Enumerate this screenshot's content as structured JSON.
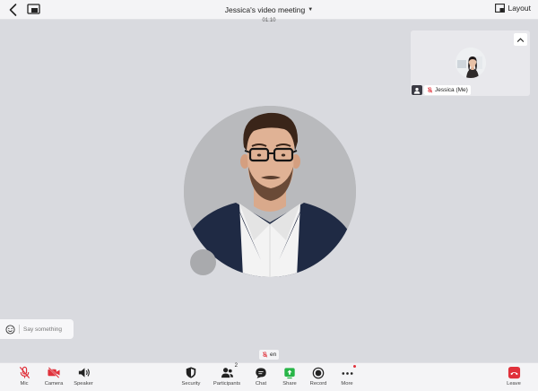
{
  "header": {
    "meeting_title": "Jessica's video meeting",
    "timer": "01:10",
    "layout_label": "Layout"
  },
  "self_view": {
    "name": "Jessica (Me)"
  },
  "chat_input": {
    "placeholder": "Say something"
  },
  "caption": {
    "language": "en"
  },
  "toolbar": {
    "mic": "Mic",
    "camera": "Camera",
    "speaker": "Speaker",
    "security": "Security",
    "participants": "Participants",
    "participants_count": "2",
    "chat": "Chat",
    "share": "Share",
    "record": "Record",
    "more": "More",
    "leave": "Leave"
  },
  "colors": {
    "muted_red": "#e0313b",
    "share_green": "#27b547",
    "stage_bg": "#d9dadf"
  }
}
